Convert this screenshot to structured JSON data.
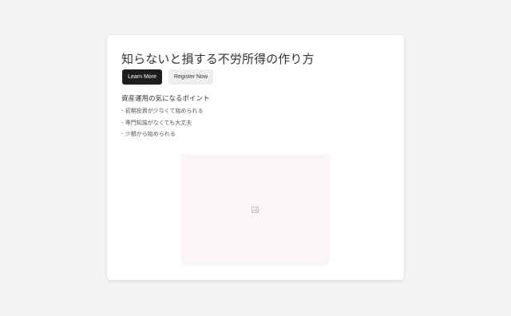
{
  "card": {
    "title": "知らないと損する不労所得の作り方",
    "buttons": {
      "learn_more": "Learn More",
      "register_now": "Register Now"
    },
    "section": {
      "title": "資産運用の気になるポイント",
      "items": [
        "- 初期投資が少なくて始められる",
        "- 専門知識がなくても大丈夫",
        "- 少額から始められる"
      ]
    },
    "image": {
      "icon": "broken-image-icon"
    }
  }
}
